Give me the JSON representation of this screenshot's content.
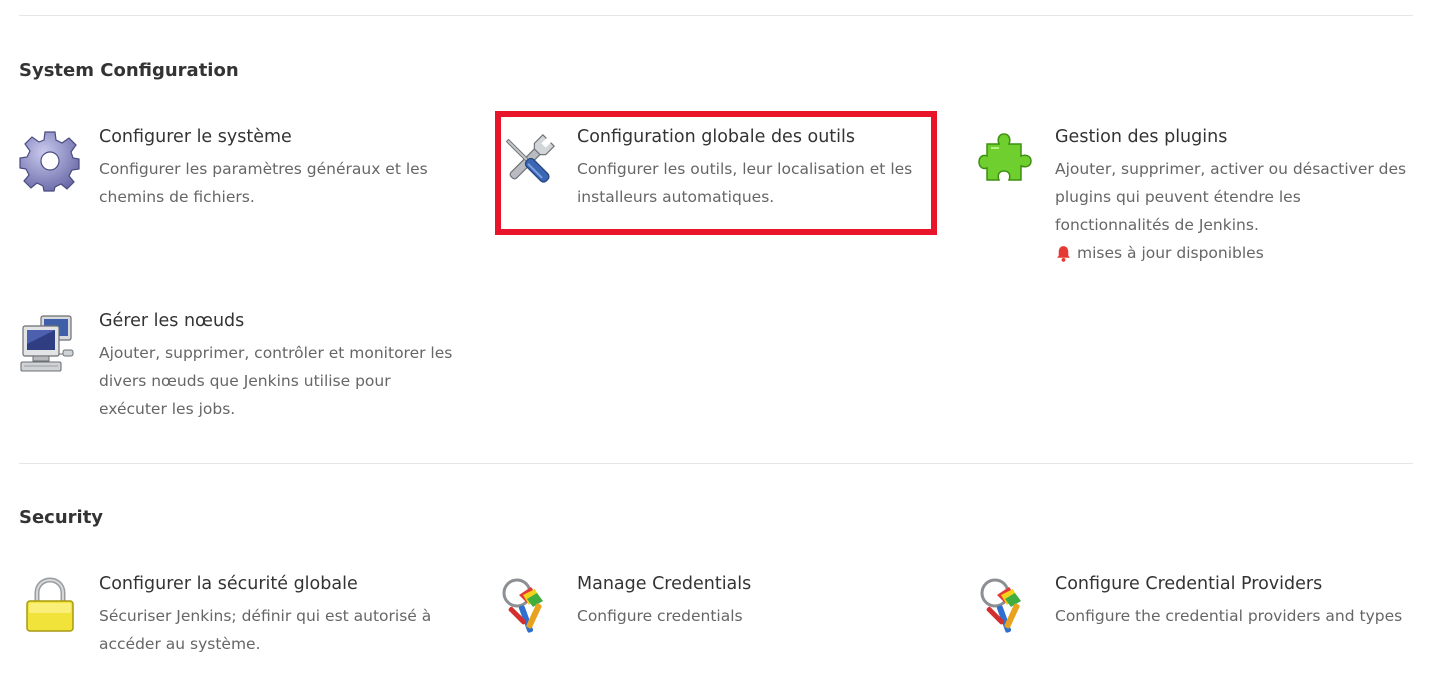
{
  "sections": [
    {
      "title": "System Configuration",
      "items": [
        {
          "icon": "gear-icon",
          "title": "Configurer le système",
          "description": "Configurer les paramètres généraux et les chemins de fichiers."
        },
        {
          "icon": "tools-icon",
          "title": "Configuration globale des outils",
          "description": "Configurer les outils, leur localisation et les installeurs automatiques."
        },
        {
          "icon": "puzzle-icon",
          "title": "Gestion des plugins",
          "description": "Ajouter, supprimer, activer ou désactiver des plugins qui peuvent étendre les fonctionnalités de Jenkins.",
          "notice": "mises à jour disponibles",
          "notice_icon": "bell-icon"
        },
        {
          "icon": "computer-icon",
          "title": "Gérer les nœuds",
          "description": "Ajouter, supprimer, contrôler et monitorer les divers nœuds que Jenkins utilise pour exécuter les jobs."
        }
      ]
    },
    {
      "title": "Security",
      "items": [
        {
          "icon": "lock-icon",
          "title": "Configurer la sécurité globale",
          "description": "Sécuriser Jenkins; définir qui est autorisé à accéder au système."
        },
        {
          "icon": "keys-icon",
          "title": "Manage Credentials",
          "description": "Configure credentials"
        },
        {
          "icon": "keys-icon",
          "title": "Configure Credential Providers",
          "description": "Configure the credential providers and types"
        }
      ]
    }
  ],
  "highlight_color": "#e8142a",
  "notice_color": "#e53935"
}
